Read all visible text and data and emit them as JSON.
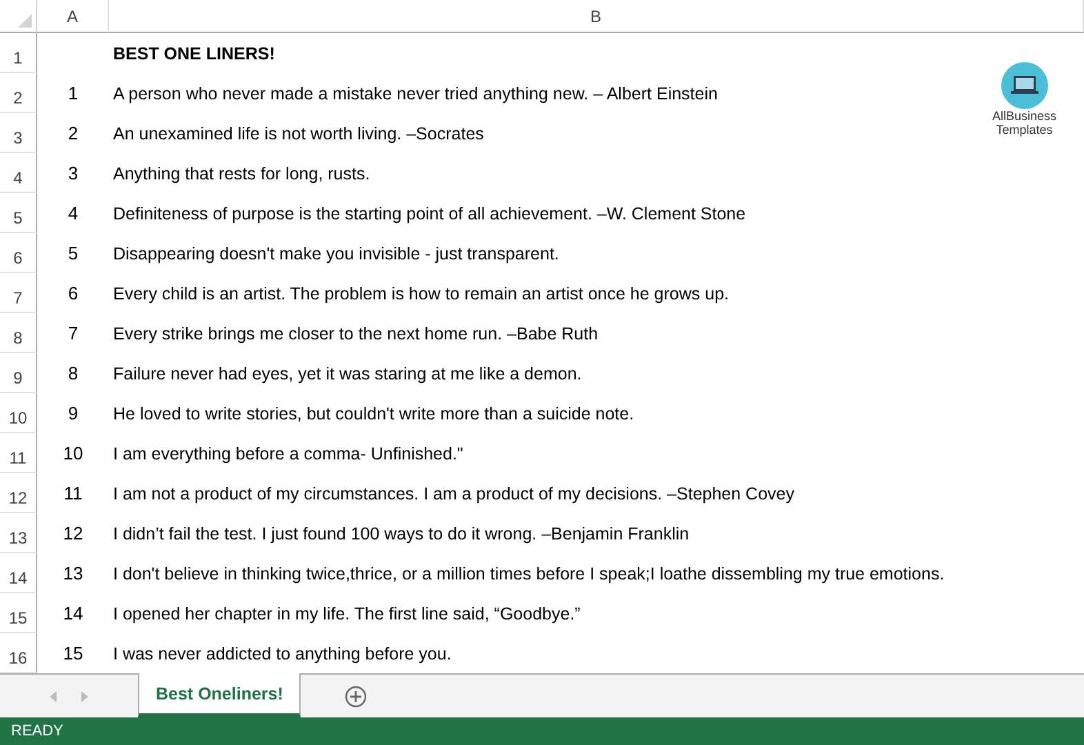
{
  "columns": [
    "A",
    "B"
  ],
  "logo": {
    "line_1": "AllBusiness",
    "line_2": "Templates"
  },
  "rows": [
    {
      "number": "1",
      "kind": "heading",
      "column_b": "BEST ONE LINERS!"
    },
    {
      "number": "2",
      "kind": "quote",
      "column_a": "1",
      "column_b": "A person who never made a mistake never tried anything new. – Albert Einstein"
    },
    {
      "number": "3",
      "kind": "quote",
      "column_a": "2",
      "column_b": "An unexamined life is not worth living. –Socrates"
    },
    {
      "number": "4",
      "kind": "quote",
      "column_a": "3",
      "column_b": "Anything that rests for long, rusts."
    },
    {
      "number": "5",
      "kind": "quote",
      "column_a": "4",
      "column_b": "Definiteness of purpose is the starting point of all achievement. –W. Clement Stone"
    },
    {
      "number": "6",
      "kind": "quote",
      "column_a": "5",
      "column_b": "Disappearing doesn't make you invisible - just transparent."
    },
    {
      "number": "7",
      "kind": "quote",
      "column_a": "6",
      "column_b": "Every child is an artist.  The problem is how to remain an artist once he grows up."
    },
    {
      "number": "8",
      "kind": "quote",
      "column_a": "7",
      "column_b": "Every strike brings me closer to the next home run. –Babe Ruth"
    },
    {
      "number": "9",
      "kind": "quote",
      "column_a": "8",
      "column_b": "Failure never had eyes, yet it was staring at me like a demon."
    },
    {
      "number": "10",
      "kind": "quote",
      "column_a": "9",
      "column_b": "He loved to write stories, but couldn't write more than a suicide note."
    },
    {
      "number": "11",
      "kind": "quote",
      "column_a": "10",
      "column_b": "I am everything before a comma- Unfinished.\""
    },
    {
      "number": "12",
      "kind": "quote",
      "column_a": "11",
      "column_b": "I am not a product of my circumstances. I am a product of my decisions. –Stephen Covey"
    },
    {
      "number": "13",
      "kind": "quote",
      "column_a": "12",
      "column_b": "I didn’t fail the test. I just found 100 ways to do it wrong. –Benjamin Franklin"
    },
    {
      "number": "14",
      "kind": "quote",
      "column_a": "13",
      "column_b": "I don't believe in thinking twice,thrice, or a million times before I speak;I loathe dissembling my true emotions."
    },
    {
      "number": "15",
      "kind": "quote",
      "column_a": "14",
      "column_b": "I opened her chapter in my life. The first line said, “Goodbye.”"
    },
    {
      "number": "16",
      "kind": "quote",
      "column_a": "15",
      "column_b": "I was never addicted to anything before you."
    }
  ],
  "sheet_tabs": [
    {
      "label": "Best Oneliners!",
      "selected": true
    }
  ],
  "status_bar": "READY"
}
